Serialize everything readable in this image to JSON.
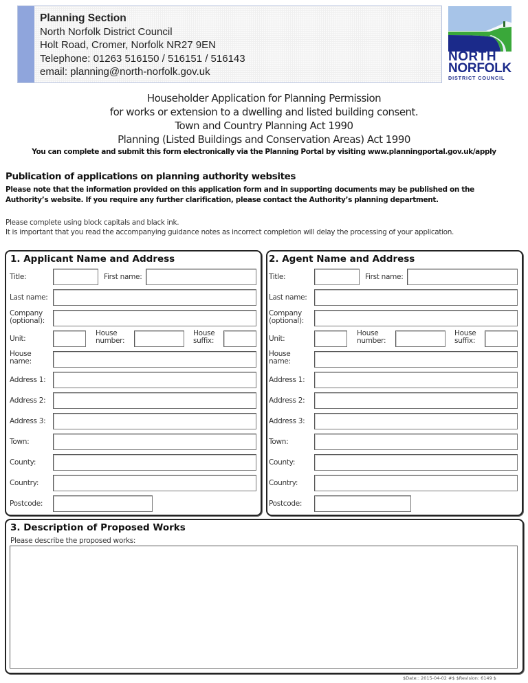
{
  "header": {
    "office_title": "Planning Section",
    "council": "North Norfolk District Council",
    "address": "Holt Road, Cromer, Norfolk  NR27 9EN",
    "telephone": "Telephone: 01263  516150 / 516151 / 516143",
    "email": "email:  planning@north-norfolk.gov.uk",
    "accent_color": "#8fa5dc"
  },
  "logo": {
    "line1": "NORTH",
    "line2": "NORFOLK",
    "line3": "DISTRICT COUNCIL",
    "colors": {
      "navy": "#1b2a8a",
      "green": "#3aa83a",
      "sky": "#a7c4e8"
    }
  },
  "form_title": {
    "line1": "Householder Application for Planning Permission",
    "line2": "for works or extension to a dwelling and listed building consent.",
    "line3": "Town and Country Planning Act 1990",
    "line4": "Planning (Listed Buildings and Conservation Areas) Act 1990"
  },
  "portal_note": "You can complete and submit this form electronically via the Planning Portal by visiting www.planningportal.gov.uk/apply",
  "publication": {
    "heading": "Publication of applications on planning authority websites",
    "note": "Please note that the information provided on this application form and in supporting documents may be published on the Authority’s website. If you require any further clarification, please contact the Authority’s planning department."
  },
  "instructions": {
    "line1": "Please complete using block capitals and black ink.",
    "line2": "It is important that you read the accompanying guidance notes as incorrect completion will delay the  processing of your application."
  },
  "labels": {
    "title": "Title:",
    "first_name": "First name:",
    "last_name": "Last name:",
    "company_1": "Company",
    "company_2": "(optional):",
    "unit": "Unit:",
    "house_number_1": "House",
    "house_number_2": "number:",
    "house_suffix_1": "House",
    "house_suffix_2": "suffix:",
    "house_name_1": "House",
    "house_name_2": "name:",
    "address1": "Address 1:",
    "address2": "Address 2:",
    "address3": "Address 3:",
    "town": "Town:",
    "county": "County:",
    "country": "Country:",
    "postcode": "Postcode:"
  },
  "applicant": {
    "heading": "1.  Applicant Name and Address",
    "values": {
      "title": "",
      "first_name": "",
      "last_name": "",
      "company": "",
      "unit": "",
      "house_number": "",
      "house_suffix": "",
      "house_name": "",
      "address1": "",
      "address2": "",
      "address3": "",
      "town": "",
      "county": "",
      "country": "",
      "postcode": ""
    }
  },
  "agent": {
    "heading": "2.  Agent Name and Address",
    "values": {
      "title": "",
      "first_name": "",
      "last_name": "",
      "company": "",
      "unit": "",
      "house_number": "",
      "house_suffix": "",
      "house_name": "",
      "address1": "",
      "address2": "",
      "address3": "",
      "town": "",
      "county": "",
      "country": "",
      "postcode": ""
    }
  },
  "description": {
    "heading": "3.  Description of Proposed Works",
    "prompt": "Please describe the proposed works:",
    "value": ""
  },
  "footer": {
    "revision": "$Date:: 2015-04-02 #$ $Revision: 6149 $"
  }
}
